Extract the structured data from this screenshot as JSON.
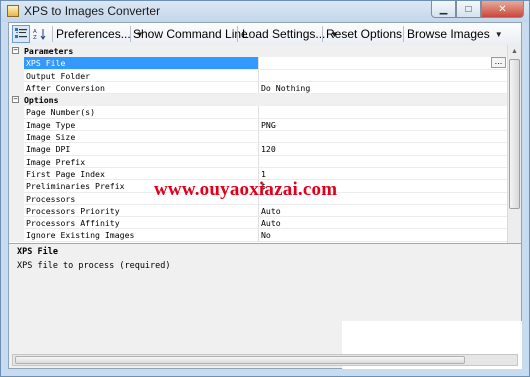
{
  "window": {
    "title": "XPS to Images Converter",
    "controls": {
      "minimize": "▁",
      "maximize": "□",
      "close": "✕"
    }
  },
  "toolbar": {
    "categorized_icon": "categorized-view-icon",
    "sort_icon": "alphabetical-sort-icon",
    "menus": [
      "Preferences...",
      "Show Command Line",
      "Load Settings...",
      "Reset Options",
      "Browse Images"
    ]
  },
  "property_grid": {
    "categories": [
      {
        "name": "Parameters",
        "expanded": true,
        "properties": [
          {
            "name": "XPS File",
            "value": "",
            "selected": true,
            "has_browse": true
          },
          {
            "name": "Output Folder",
            "value": ""
          },
          {
            "name": "After Conversion",
            "value": "Do Nothing"
          }
        ]
      },
      {
        "name": "Options",
        "expanded": true,
        "properties": [
          {
            "name": "Page Number(s)",
            "value": ""
          },
          {
            "name": "Image Type",
            "value": "PNG"
          },
          {
            "name": "Image Size",
            "value": ""
          },
          {
            "name": "Image DPI",
            "value": "120"
          },
          {
            "name": "Image Prefix",
            "value": ""
          },
          {
            "name": "First Page Index",
            "value": "1"
          },
          {
            "name": "Preliminaries Prefix",
            "value": "$"
          },
          {
            "name": "Processors",
            "value": ""
          },
          {
            "name": "Processors Priority",
            "value": "Auto"
          },
          {
            "name": "Processors Affinity",
            "value": "Auto"
          },
          {
            "name": "Ignore Existing Images",
            "value": "No"
          }
        ]
      }
    ],
    "browse_button_label": "..."
  },
  "help": {
    "title": "XPS File",
    "description": "XPS file to process (required)"
  },
  "watermark": "www.ouyaoxiazai.com",
  "colors": {
    "selection": "#3399ff",
    "watermark": "#e0001b",
    "titlebar": "#c9dcef"
  }
}
